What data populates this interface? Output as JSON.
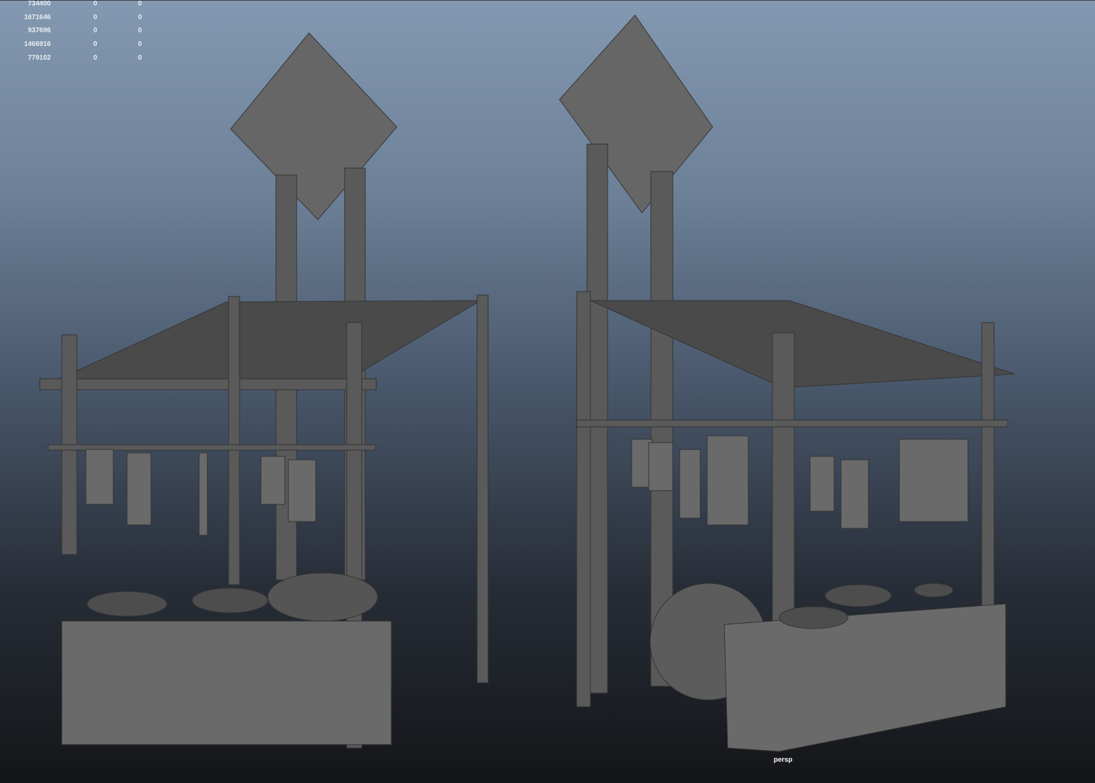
{
  "viewport": {
    "camera_label": "persp"
  },
  "heads_up_display": {
    "rows": [
      [
        "734400",
        "0",
        "0"
      ],
      [
        "1671646",
        "0",
        "0"
      ],
      [
        "937696",
        "0",
        "0"
      ],
      [
        "1466916",
        "0",
        "0"
      ],
      [
        "779102",
        "0",
        "0"
      ]
    ]
  },
  "colors": {
    "model": "#5a5a5a",
    "model_dark": "#3e3e3e",
    "bg_top": "#8399b1",
    "bg_bottom": "#141518"
  }
}
